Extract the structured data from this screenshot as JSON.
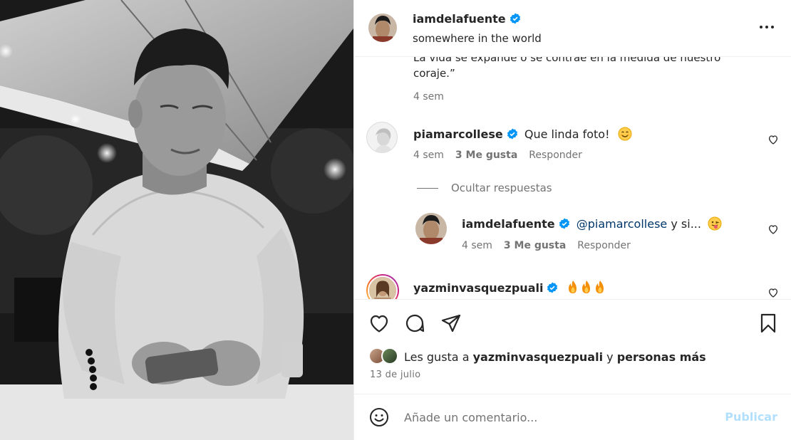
{
  "post": {
    "username": "iamdelafuente",
    "location": "somewhere in the world"
  },
  "caption": {
    "text_tail": "La vida se expande o se contrae en la medida de nuestro coraje.”",
    "time": "4 sem"
  },
  "comments": [
    {
      "username": "piamarcollese",
      "text": "Que linda foto!",
      "emoji": "smiling-face-emoji",
      "time": "4 sem",
      "likes": "3 Me gusta",
      "reply_label": "Responder"
    }
  ],
  "hide_replies_label": "Ocultar respuestas",
  "reply": {
    "username": "iamdelafuente",
    "mention": "@piamarcollese",
    "text": "y si...",
    "emoji": "tongue-out-emoji",
    "time": "4 sem",
    "likes": "3 Me gusta",
    "reply_label": "Responder"
  },
  "comment3": {
    "username": "yazminvasquezpuali",
    "emoji": "fire-emoji x3"
  },
  "likes_line": {
    "prefix": "Les gusta a",
    "user": "yazminvasquezpuali",
    "middle": "y",
    "suffix": "personas más"
  },
  "date": "13 de julio",
  "comment_box": {
    "placeholder": "Añade un comentario...",
    "publish_label": "Publicar"
  },
  "colors": {
    "verified": "#0095f6",
    "publish_disabled": "#b2dffc",
    "secondary_text": "#737373",
    "mention": "#00376b"
  }
}
